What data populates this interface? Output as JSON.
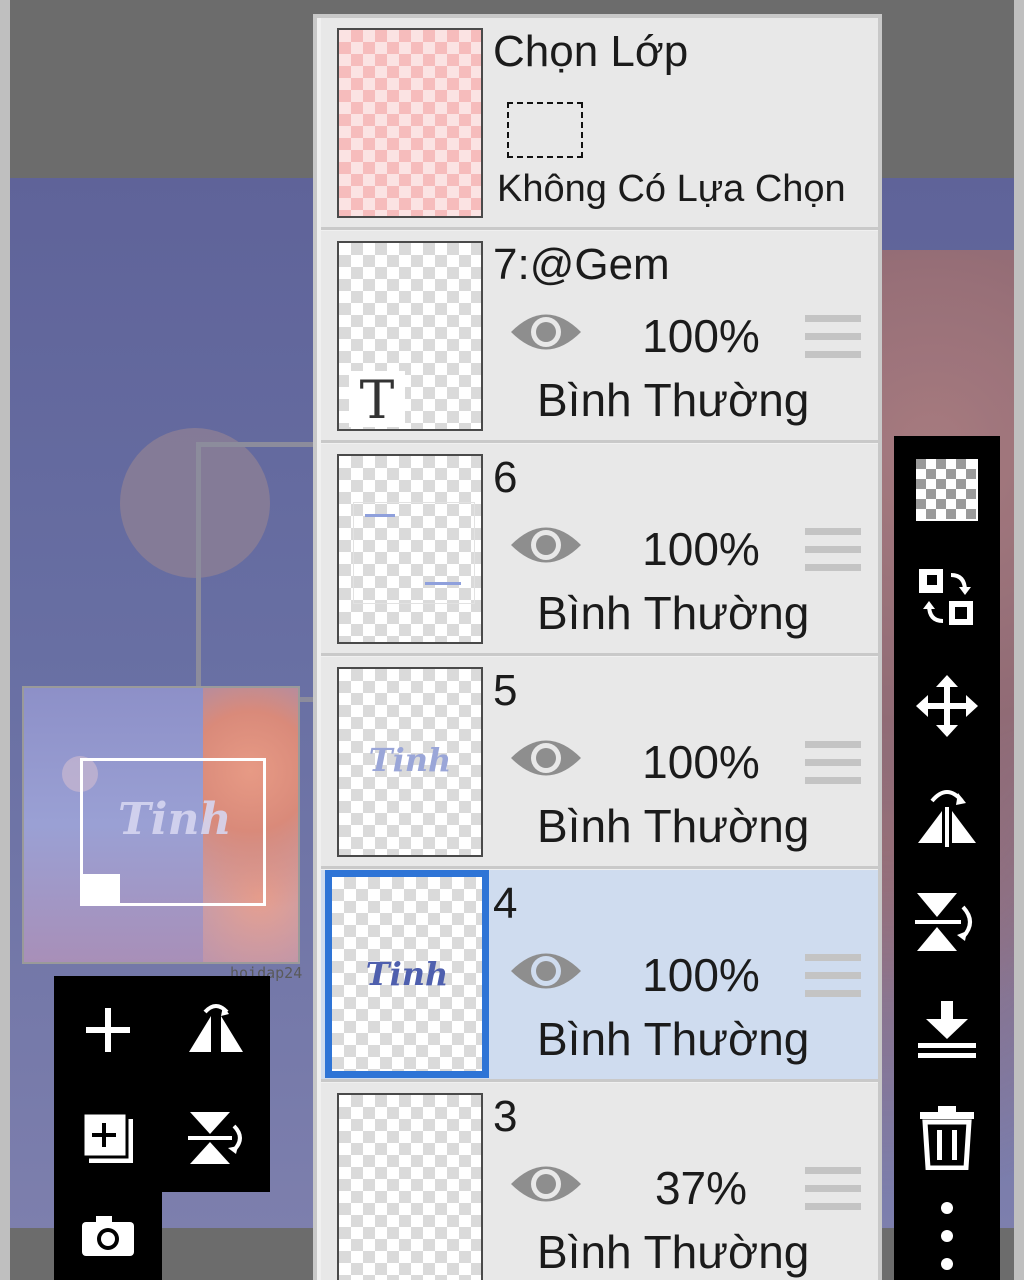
{
  "selection_row": {
    "title": "Chọn Lớp",
    "status": "Không Có Lựa Chọn"
  },
  "layers": [
    {
      "name": "7:@Gem",
      "opacity": "100%",
      "blend": "Bình Thường",
      "visible": true,
      "selected": false,
      "thumb_glyph": "T"
    },
    {
      "name": "6",
      "opacity": "100%",
      "blend": "Bình Thường",
      "visible": true,
      "selected": false
    },
    {
      "name": "5",
      "opacity": "100%",
      "blend": "Bình Thường",
      "visible": true,
      "selected": false,
      "thumb_word": "Tinh"
    },
    {
      "name": "4",
      "opacity": "100%",
      "blend": "Bình Thường",
      "visible": true,
      "selected": true,
      "thumb_word": "Tinh"
    },
    {
      "name": "3",
      "opacity": "37%",
      "blend": "Bình Thường",
      "visible": true,
      "selected": false
    }
  ],
  "navigator": {
    "word": "Tinh"
  },
  "watermark": "hoidap24",
  "left_tools": [
    "add-layer-icon",
    "flip-horizontal-icon",
    "add-layer-copy-icon",
    "flip-vertical-icon",
    "camera-icon"
  ],
  "right_tools": [
    "transparency-icon",
    "swap-layers-icon",
    "move-icon",
    "flip-layer-horizontal-icon",
    "flip-layer-vertical-icon",
    "merge-down-icon",
    "delete-icon",
    "more-icon"
  ],
  "colors": {
    "selected_row": "#cfdcef",
    "selected_border": "#2e74d6",
    "toolbar": "#000000",
    "panel": "#e8e8e8"
  }
}
